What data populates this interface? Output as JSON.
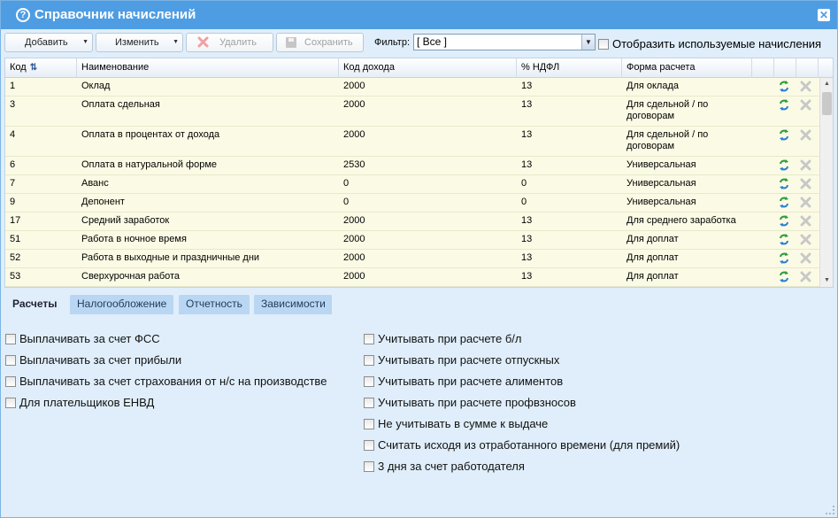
{
  "window": {
    "title": "Справочник начислений"
  },
  "toolbar": {
    "add_label": "Добавить",
    "edit_label": "Изменить",
    "delete_label": "Удалить",
    "save_label": "Сохранить",
    "filter_label": "Фильтр:",
    "filter_value": "[ Все ]",
    "show_used_label": "Отобразить используемые начисления"
  },
  "grid": {
    "columns": [
      "Код",
      "Наименование",
      "Код дохода",
      "% НДФЛ",
      "Форма расчета"
    ],
    "rows": [
      {
        "code": "1",
        "name": "Оклад",
        "income_code": "2000",
        "ndfl": "13",
        "form": "Для оклада"
      },
      {
        "code": "3",
        "name": "Оплата сдельная",
        "income_code": "2000",
        "ndfl": "13",
        "form": "Для сдельной / по договорам"
      },
      {
        "code": "4",
        "name": "Оплата в процентах от дохода",
        "income_code": "2000",
        "ndfl": "13",
        "form": "Для сдельной / по договорам"
      },
      {
        "code": "6",
        "name": "Оплата в натуральной форме",
        "income_code": "2530",
        "ndfl": "13",
        "form": "Универсальная"
      },
      {
        "code": "7",
        "name": "Аванс",
        "income_code": "0",
        "ndfl": "0",
        "form": "Универсальная"
      },
      {
        "code": "9",
        "name": "Депонент",
        "income_code": "0",
        "ndfl": "0",
        "form": "Универсальная"
      },
      {
        "code": "17",
        "name": "Средний заработок",
        "income_code": "2000",
        "ndfl": "13",
        "form": "Для среднего заработка"
      },
      {
        "code": "51",
        "name": "Работа в ночное время",
        "income_code": "2000",
        "ndfl": "13",
        "form": "Для доплат"
      },
      {
        "code": "52",
        "name": "Работа в выходные и праздничные дни",
        "income_code": "2000",
        "ndfl": "13",
        "form": "Для доплат"
      },
      {
        "code": "53",
        "name": "Сверхурочная работа",
        "income_code": "2000",
        "ndfl": "13",
        "form": "Для доплат"
      }
    ]
  },
  "tabs": [
    "Расчеты",
    "Налогообложение",
    "Отчетность",
    "Зависимости"
  ],
  "options_left": [
    "Выплачивать за счет ФСС",
    "Выплачивать за счет прибыли",
    "Выплачивать за счет страхования от н/с на производстве",
    "Для плательщиков ЕНВД"
  ],
  "options_right": [
    "Учитывать при расчете б/л",
    "Учитывать при расчете отпускных",
    "Учитывать при расчете алиментов",
    "Учитывать при расчете профвзносов",
    "Не учитывать в сумме к выдаче",
    "Считать исходя из отработанного времени (для премий)",
    "3 дня за счет работодателя"
  ],
  "colors": {
    "titlebar": "#4e9de3",
    "panel": "#dfeefa",
    "row": "#fbfbe5",
    "tab": "#b9d6f2",
    "refresh_icon": "#2e9b3e"
  }
}
